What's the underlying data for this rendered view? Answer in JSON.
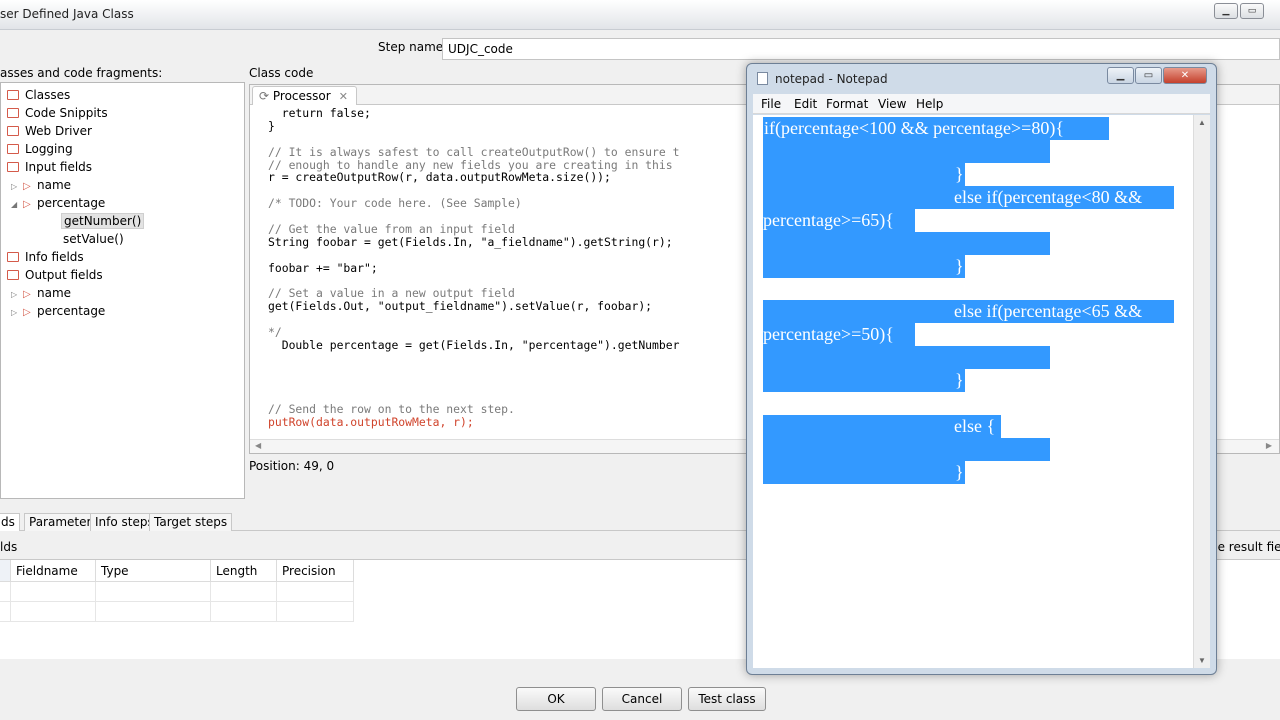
{
  "window": {
    "title": "ser Defined Java Class",
    "min_icon": "minimize-icon",
    "max_icon": "maximize-icon"
  },
  "step": {
    "label": "Step name",
    "value": "UDJC_code"
  },
  "tree": {
    "caption": "asses and code fragments:",
    "items": [
      {
        "label": "Classes"
      },
      {
        "label": "Code Snippits"
      },
      {
        "label": "Web Driver"
      },
      {
        "label": "Logging"
      },
      {
        "label": "Input fields"
      },
      {
        "label": "name"
      },
      {
        "label": "percentage"
      },
      {
        "label": "getNumber()"
      },
      {
        "label": "setValue()"
      },
      {
        "label": "Info fields"
      },
      {
        "label": "Output fields"
      },
      {
        "label": "name"
      },
      {
        "label": "percentage"
      }
    ]
  },
  "code": {
    "caption": "Class code",
    "tab": "Processor",
    "lines": [
      "  return false;",
      "}",
      "",
      "// It is always safest to call createOutputRow() to ensure t",
      "// enough to handle any new fields you are creating in this",
      "r = createOutputRow(r, data.outputRowMeta.size());",
      "",
      "/* TODO: Your code here. (See Sample)",
      "",
      "// Get the value from an input field",
      "String foobar = get(Fields.In, \"a_fieldname\").getString(r);",
      "",
      "foobar += \"bar\";",
      "",
      "// Set a value in a new output field",
      "get(Fields.Out, \"output_fieldname\").setValue(r, foobar);",
      "",
      "*/",
      "  Double percentage = get(Fields.In, \"percentage\").getNumber",
      "",
      "",
      "",
      "",
      "// Send the row on to the next step.",
      "putRow(data.outputRowMeta, r);"
    ],
    "position": "Position: 49, 0"
  },
  "bottom_tabs": [
    "ds",
    "Parameters",
    "Info steps",
    "Target steps"
  ],
  "fields": {
    "caption": "lds",
    "result_caption": "he result field",
    "columns": [
      "Fieldname",
      "Type",
      "Length",
      "Precision"
    ]
  },
  "buttons": {
    "ok": "OK",
    "cancel": "Cancel",
    "test": "Test class"
  },
  "notepad": {
    "title": "notepad - Notepad",
    "menu": [
      "File",
      "Edit",
      "Format",
      "View",
      "Help"
    ],
    "lines": [
      "if(percentage<100 && percentage>=80){",
      "",
      "}",
      "else if(percentage<80 &&",
      "percentage>=65){",
      "",
      "}",
      "else if(percentage<65 &&",
      "percentage>=50){",
      "",
      "}",
      "else {",
      "",
      "}"
    ]
  },
  "colors": {
    "selection": "#3399ff",
    "folder": "#d45a4a",
    "keyword": "#d0442c"
  }
}
